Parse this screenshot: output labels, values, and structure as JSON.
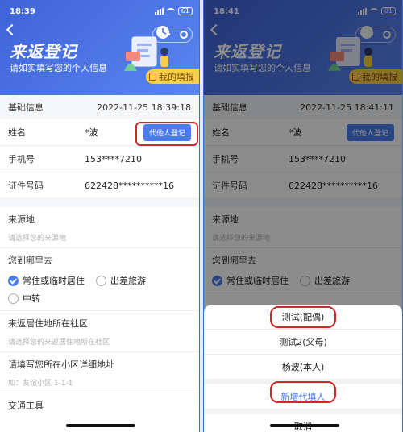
{
  "left": {
    "status_time": "18:39",
    "battery": "61",
    "timestamp": "2022-11-25 18:39:18"
  },
  "right": {
    "status_time": "18:41",
    "battery": "61",
    "timestamp": "2022-11-25 18:41:11",
    "sheet_options": [
      "测试(配偶)",
      "测试2(父母)",
      "杨波(本人)"
    ],
    "add_option": "新增代填人",
    "cancel": "取消"
  },
  "header": {
    "title": "来返登记",
    "subtitle": "请如实填写您的个人信息",
    "my_fill_button": "我的填报",
    "capsule_more": "•••"
  },
  "form": {
    "basic_info": "基础信息",
    "name_label": "姓名",
    "name_value": "*波",
    "agent_button": "代他人登记",
    "phone_label": "手机号",
    "phone_value": "153****7210",
    "id_label": "证件号码",
    "id_value": "622428**********16",
    "origin_label": "来源地",
    "origin_placeholder": "请选择您的来源地",
    "destination_label": "您到哪里去",
    "radio_resident": "常住或临时居住",
    "radio_trip": "出差旅游",
    "radio_transit": "中转",
    "community_label": "来返居住地所在社区",
    "community_placeholder": "请选择您的来返居住地所在社区",
    "address_label": "请填写您所在小区详细地址",
    "address_placeholder": "如：友谊小区 1-1-1",
    "transport_label": "交通工具"
  },
  "colors": {
    "header_blue": "#3f63d8",
    "accent_blue": "#4a7cf0",
    "highlight_red": "#d0282a",
    "button_yellow": "#f7d04a"
  }
}
